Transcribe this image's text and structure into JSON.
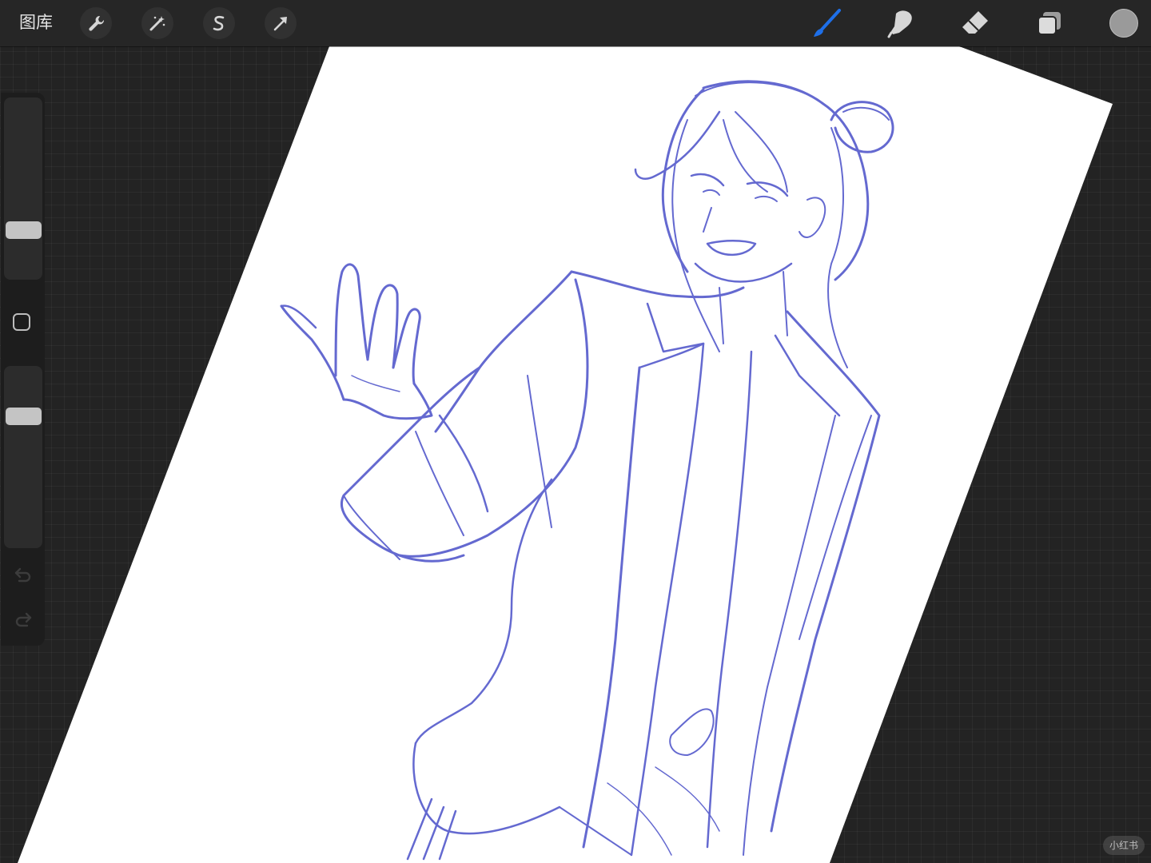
{
  "topbar": {
    "gallery_label": "图库",
    "left_tools": [
      {
        "name": "actions",
        "icon": "wrench-icon"
      },
      {
        "name": "adjustments",
        "icon": "magic-wand-icon"
      },
      {
        "name": "selection",
        "icon": "selection-s-icon"
      },
      {
        "name": "transform",
        "icon": "arrow-cursor-icon"
      }
    ],
    "right_tools": [
      {
        "name": "brush",
        "icon": "brush-icon",
        "active": true
      },
      {
        "name": "smudge",
        "icon": "smudge-finger-icon",
        "active": false
      },
      {
        "name": "eraser",
        "icon": "eraser-icon",
        "active": false
      },
      {
        "name": "layers",
        "icon": "layers-icon",
        "active": false
      }
    ],
    "current_color": "#9a9a9a",
    "active_accent": "#1e6fe8"
  },
  "sidebar": {
    "brush_size_level": 0.25,
    "opacity_level": 0.75,
    "modify_icon": "square-modify-icon",
    "undo_icon": "undo-arrow-icon",
    "redo_icon": "redo-arrow-icon"
  },
  "canvas": {
    "paper_color": "#ffffff",
    "sketch_color": "#4a50c8",
    "subject": "sketch-figure"
  },
  "watermark": "小红书"
}
